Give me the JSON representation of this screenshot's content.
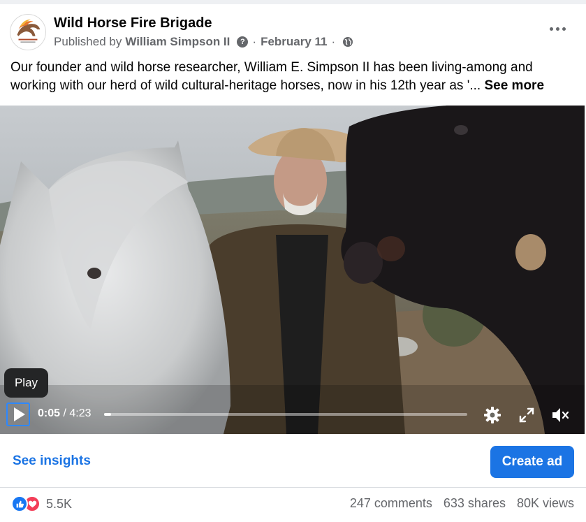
{
  "post": {
    "page_name": "Wild Horse Fire Brigade",
    "published_by_prefix": "Published by",
    "author": "William Simpson II",
    "date": "February 11",
    "separator": "·",
    "text": "Our founder and wild horse researcher, William E. Simpson II has been living-among and working with our herd of wild cultural-heritage horses, now in his 12th year as '...",
    "see_more": "See more",
    "avatar_logo_text": "WILD HORSE FIRE BRIGADE"
  },
  "video": {
    "tooltip": "Play",
    "current_time": "0:05",
    "total_time": "/ 4:23",
    "progress_fraction": 0.02,
    "icons": [
      "play-icon",
      "gear-icon",
      "fullscreen-icon",
      "mute-icon"
    ]
  },
  "actions": {
    "see_insights": "See insights",
    "create_ad": "Create ad"
  },
  "stats": {
    "reactions_count": "5.5K",
    "comments": "247 comments",
    "shares": "633 shares",
    "views": "80K views"
  },
  "colors": {
    "accent": "#1b74e4",
    "like": "#1877f2",
    "love": "#f33e58",
    "secondary_text": "#65676b"
  }
}
